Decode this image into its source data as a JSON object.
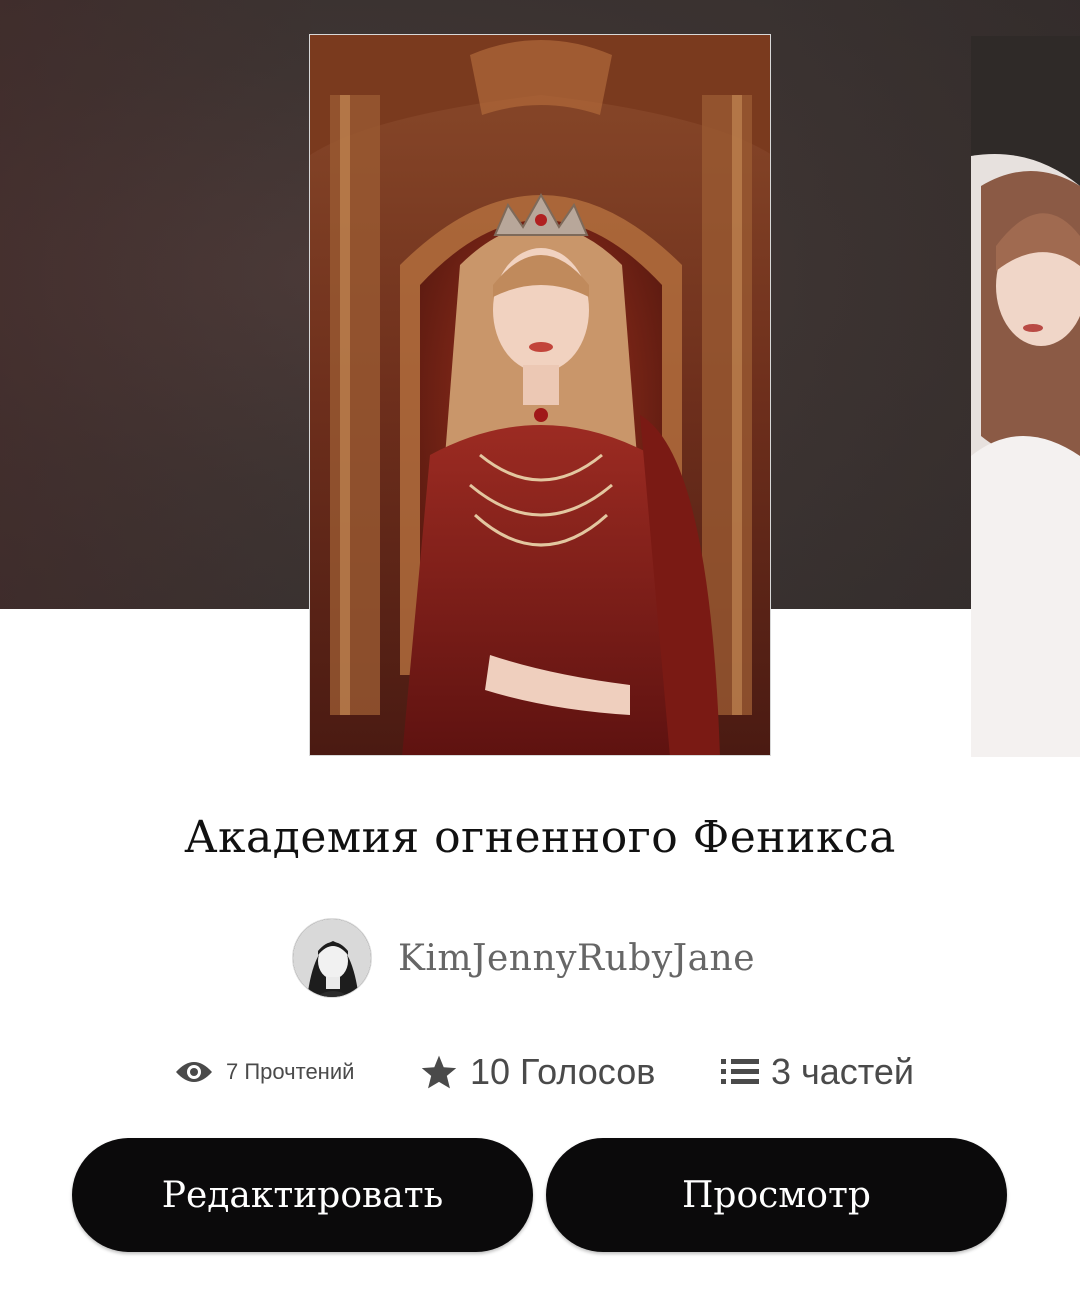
{
  "story": {
    "title": "Академия огненного Феникса",
    "author": "KimJennyRubyJane"
  },
  "stats": {
    "reads": "7 Прочтений",
    "votes": "10 Голосов",
    "parts": "3 частей"
  },
  "actions": {
    "edit_label": "Редактировать",
    "view_label": "Просмотр"
  },
  "icons": {
    "reads": "eye-icon",
    "votes": "star-icon",
    "parts": "list-icon"
  },
  "colors": {
    "button_bg": "#0b0a0b",
    "button_text": "#ffffff",
    "hero_bg": "#3d3432",
    "stat_text": "#4a4a4a"
  }
}
